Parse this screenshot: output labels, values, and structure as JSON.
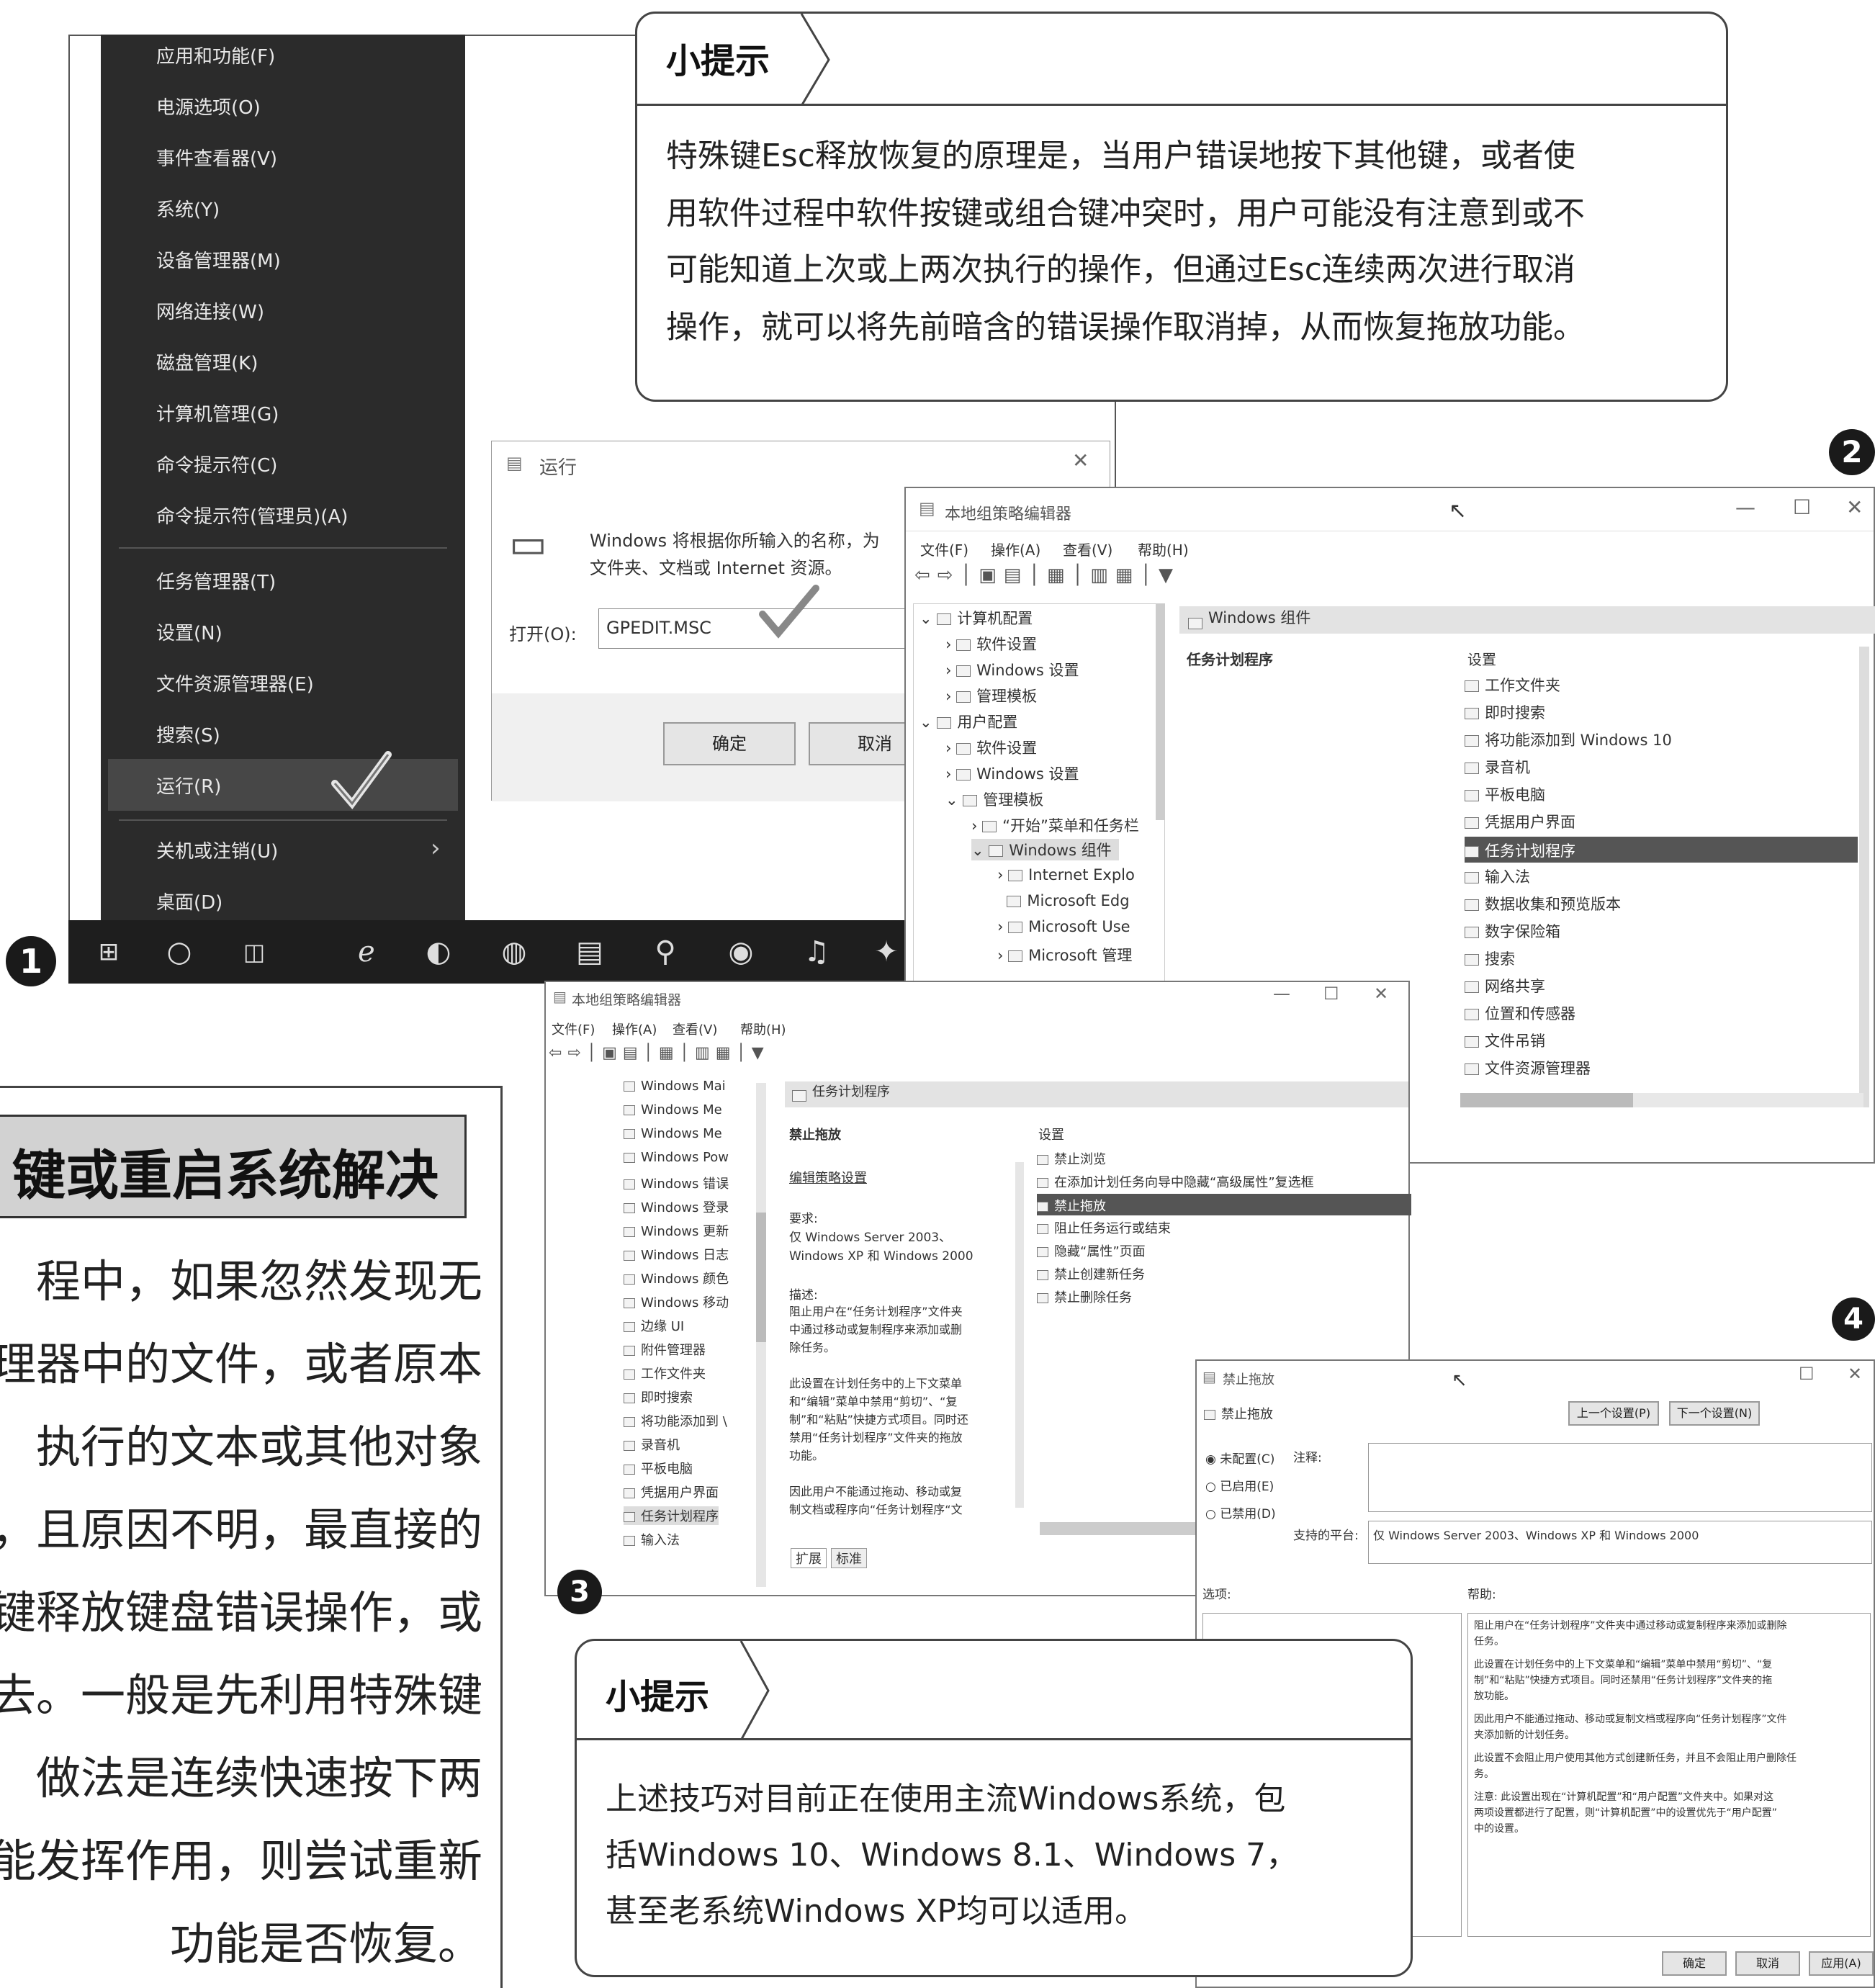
{
  "start_menu": {
    "items": [
      "应用和功能(F)",
      "电源选项(O)",
      "事件查看器(V)",
      "系统(Y)",
      "设备管理器(M)",
      "网络连接(W)",
      "磁盘管理(K)",
      "计算机管理(G)",
      "命令提示符(C)",
      "命令提示符(管理员)(A)",
      "任务管理器(T)",
      "设置(N)",
      "文件资源管理器(E)",
      "搜索(S)",
      "运行(R)",
      "关机或注销(U)",
      "桌面(D)"
    ],
    "highlighted": "运行(R)"
  },
  "step_numbers": [
    "1",
    "2",
    "3",
    "4"
  ],
  "tip1": {
    "title": "小提示",
    "lines": [
      "特殊键Esc释放恢复的原理是，当用户错误地按下其他键，或者使",
      "用软件过程中软件按键或组合键冲突时，用户可能没有注意到或不",
      "可能知道上次或上两次执行的操作，但通过Esc连续两次进行取消",
      "操作，就可以将先前暗含的错误操作取消掉，从而恢复拖放功能。"
    ]
  },
  "run_dialog": {
    "title": "运行",
    "desc_line1": "Windows 将根据你所输入的名称，为",
    "desc_line2": "文件夹、文档或 Internet 资源。",
    "open_label": "打开(O):",
    "open_value": "GPEDIT.MSC",
    "ok": "确定",
    "cancel": "取消"
  },
  "gpedit1": {
    "title": "本地组策略编辑器",
    "menu": [
      "文件(F)",
      "操作(A)",
      "查看(V)",
      "帮助(H)"
    ],
    "tree": [
      "计算机配置",
      "软件设置",
      "Windows 设置",
      "管理模板",
      "用户配置",
      "软件设置",
      "Windows 设置",
      "管理模板",
      "“开始”菜单和任务栏",
      "Windows 组件",
      "Internet Explo",
      "Microsoft Edg",
      "Microsoft Use",
      "Microsoft 管理"
    ],
    "panel_title": "Windows 组件",
    "left_label": "任务计划程序",
    "list_header": "设置",
    "list": [
      "工作文件夹",
      "即时搜索",
      "将功能添加到 Windows 10",
      "录音机",
      "平板电脑",
      "凭据用户界面",
      "任务计划程序",
      "输入法",
      "数据收集和预览版本",
      "数字保险箱",
      "搜索",
      "网络共享",
      "位置和传感器",
      "文件吊销",
      "文件资源管理器"
    ],
    "selected": "任务计划程序"
  },
  "gpedit2": {
    "title": "本地组策略编辑器",
    "menu": [
      "文件(F)",
      "操作(A)",
      "查看(V)",
      "帮助(H)"
    ],
    "tree": [
      "Windows Mai",
      "Windows Me",
      "Windows Me",
      "Windows Pow",
      "Windows 错误",
      "Windows 登录",
      "Windows 更新",
      "Windows 日志",
      "Windows 颜色",
      "Windows 移动",
      "边缘 UI",
      "附件管理器",
      "工作文件夹",
      "即时搜索",
      "将功能添加到 \\",
      "录音机",
      "平板电脑",
      "凭据用户界面",
      "任务计划程序",
      "输入法"
    ],
    "panel_title": "任务计划程序",
    "policy_name": "禁止拖放",
    "edit_link": "编辑策略设置",
    "req_label": "要求:",
    "req_text": [
      "仅 Windows Server 2003、",
      "Windows XP 和 Windows 2000"
    ],
    "desc_label": "描述:",
    "desc_text": [
      "阻止用户在“任务计划程序”文件夹",
      "中通过移动或复制程序来添加或删",
      "除任务。",
      "",
      "此设置在计划任务中的上下文菜单",
      "和“编辑”菜单中禁用“剪切”、“复",
      "制”和“粘贴”快捷方式项目。同时还",
      "禁用“任务计划程序”文件夹的拖放",
      "功能。",
      "",
      "因此用户不能通过拖动、移动或复",
      "制文档或程序向“任务计划程序“文"
    ],
    "list_header": "设置",
    "list": [
      "禁止浏览",
      "在添加计划任务向导中隐藏“高级属性”复选框",
      "禁止拖放",
      "阻止任务运行或结束",
      "隐藏“属性”页面",
      "禁止创建新任务",
      "禁止删除任务"
    ],
    "selected": "禁止拖放",
    "tabs": [
      "扩展",
      "标准"
    ]
  },
  "policy_dialog": {
    "title": "禁止拖放",
    "header_name": "禁止拖放",
    "prev": "上一个设置(P)",
    "next": "下一个设置(N)",
    "radios": [
      "未配置(C)",
      "已启用(E)",
      "已禁用(D)"
    ],
    "comment_label": "注释:",
    "platform_label": "支持的平台:",
    "platform_value": "仅 Windows Server 2003、Windows XP 和 Windows 2000",
    "options_label": "选项:",
    "help_label": "帮助:",
    "help": [
      "阻止用户在“任务计划程序”文件夹中通过移动或复制程序来添加或删除",
      "任务。",
      "此设置在计划任务中的上下文菜单和“编辑”菜单中禁用“剪切”、“复",
      "制”和“粘贴”快捷方式项目。同时还禁用“任务计划程序”文件夹的拖",
      "放功能。",
      "因此用户不能通过拖动、移动或复制文档或程序向“任务计划程序”文件",
      "夹添加新的计划任务。",
      "此设置不会阻止用户使用其他方式创建新任务，并且不会阻止用户删除任",
      "务。",
      "注意: 此设置出现在“计算机配置”和“用户配置”文件夹中。如果对这",
      "两项设置都进行了配置，则“计算机配置”中的设置优先于“用户配置”",
      "中的设置。"
    ],
    "ok": "确定",
    "cancel": "取消",
    "apply": "应用(A)"
  },
  "article": {
    "heading": "键或重启系统解决",
    "lines": [
      "程中，如果忽然发现无",
      "理器中的文件，或者原本",
      "执行的文本或其他对象",
      "，且原因不明，最直接的",
      "键释放键盘错误操作，或",
      "去。一般是先利用特殊键",
      "做法是连续快速按下两",
      "能发挥作用，则尝试重新",
      "功能是否恢复。"
    ]
  },
  "tip2": {
    "title": "小提示",
    "lines": [
      "上述技巧对目前正在使用主流Windows系统，包",
      "括Windows 10、Windows 8.1、Windows 7，",
      "甚至老系统Windows XP均可以适用。"
    ]
  }
}
